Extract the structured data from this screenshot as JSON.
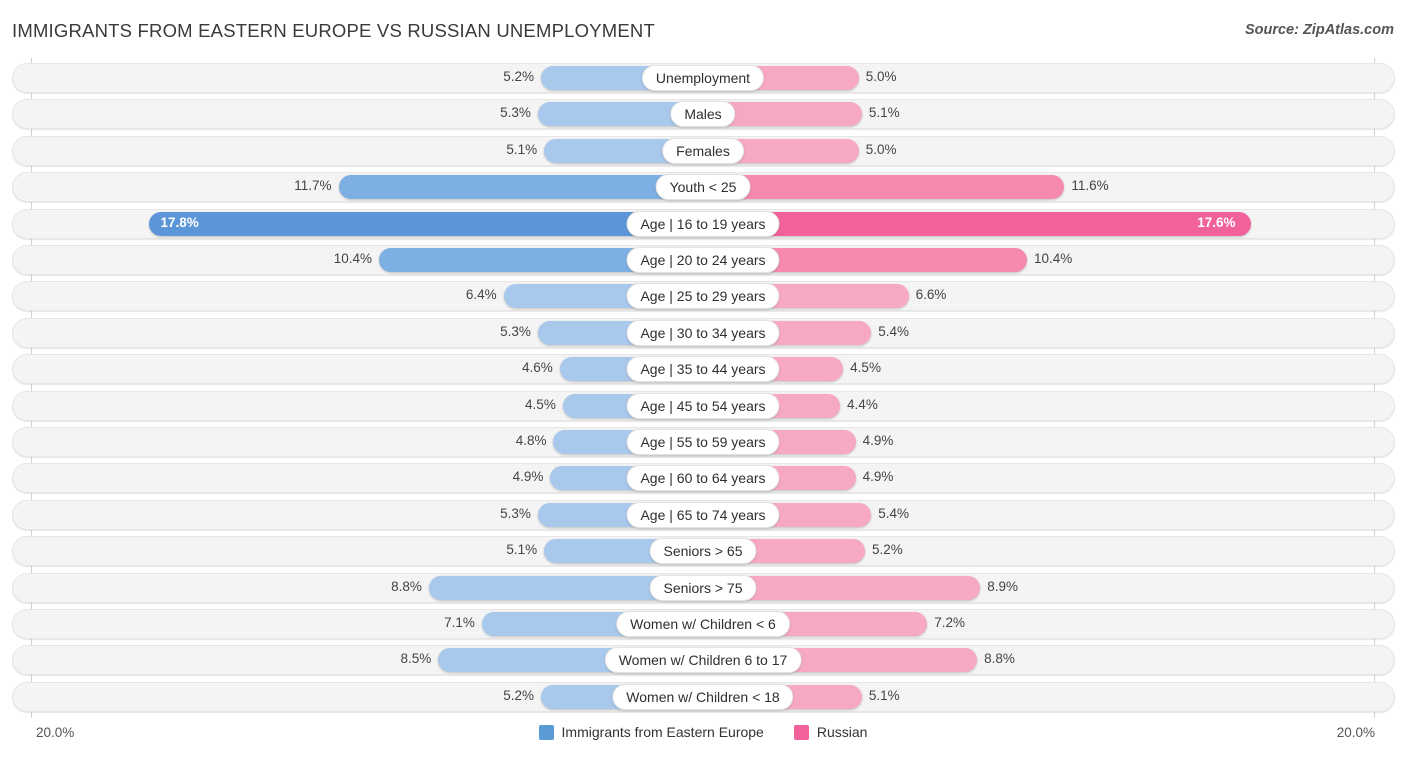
{
  "header": {
    "title": "IMMIGRANTS FROM EASTERN EUROPE VS RUSSIAN UNEMPLOYMENT",
    "source": "Source: ZipAtlas.com"
  },
  "axis": {
    "left_max_label": "20.0%",
    "right_max_label": "20.0%",
    "max_value": 20.0
  },
  "legend": {
    "items": [
      {
        "label": "Immigrants from Eastern Europe",
        "color": "#5b9bd5"
      },
      {
        "label": "Russian",
        "color": "#f2629a"
      }
    ]
  },
  "colors": {
    "left_light": "#a8c8ec",
    "left_mid": "#7dafe3",
    "left_strong": "#5b97d8",
    "right_light": "#f7a8c4",
    "right_mid": "#f589b0",
    "right_strong": "#f2629a",
    "track": "#f4f4f4",
    "axis": "#d2d2d2"
  },
  "chart_data": {
    "type": "bar",
    "subtype": "diverging-bidirectional",
    "title": "IMMIGRANTS FROM EASTERN EUROPE VS RUSSIAN UNEMPLOYMENT",
    "xlabel": "",
    "ylabel": "",
    "xlim": [
      20.0,
      20.0
    ],
    "unit": "%",
    "grid": false,
    "legend_position": "bottom-center",
    "categories": [
      "Unemployment",
      "Males",
      "Females",
      "Youth < 25",
      "Age | 16 to 19 years",
      "Age | 20 to 24 years",
      "Age | 25 to 29 years",
      "Age | 30 to 34 years",
      "Age | 35 to 44 years",
      "Age | 45 to 54 years",
      "Age | 55 to 59 years",
      "Age | 60 to 64 years",
      "Age | 65 to 74 years",
      "Seniors > 65",
      "Seniors > 75",
      "Women w/ Children < 6",
      "Women w/ Children 6 to 17",
      "Women w/ Children < 18"
    ],
    "series": [
      {
        "name": "Immigrants from Eastern Europe",
        "color": "#5b9bd5",
        "side": "left",
        "values": [
          5.2,
          5.3,
          5.1,
          11.7,
          17.8,
          10.4,
          6.4,
          5.3,
          4.6,
          4.5,
          4.8,
          4.9,
          5.3,
          5.1,
          8.8,
          7.1,
          8.5,
          5.2
        ],
        "labels": [
          "5.2%",
          "5.3%",
          "5.1%",
          "11.7%",
          "17.8%",
          "10.4%",
          "6.4%",
          "5.3%",
          "4.6%",
          "4.5%",
          "4.8%",
          "4.9%",
          "5.3%",
          "5.1%",
          "8.8%",
          "7.1%",
          "8.5%",
          "5.2%"
        ]
      },
      {
        "name": "Russian",
        "color": "#f2629a",
        "side": "right",
        "values": [
          5.0,
          5.1,
          5.0,
          11.6,
          17.6,
          10.4,
          6.6,
          5.4,
          4.5,
          4.4,
          4.9,
          4.9,
          5.4,
          5.2,
          8.9,
          7.2,
          8.8,
          5.1
        ],
        "labels": [
          "5.0%",
          "5.1%",
          "5.0%",
          "11.6%",
          "17.6%",
          "10.4%",
          "6.6%",
          "5.4%",
          "4.5%",
          "4.4%",
          "4.9%",
          "4.9%",
          "5.4%",
          "5.2%",
          "8.9%",
          "7.2%",
          "8.8%",
          "5.1%"
        ]
      }
    ]
  }
}
